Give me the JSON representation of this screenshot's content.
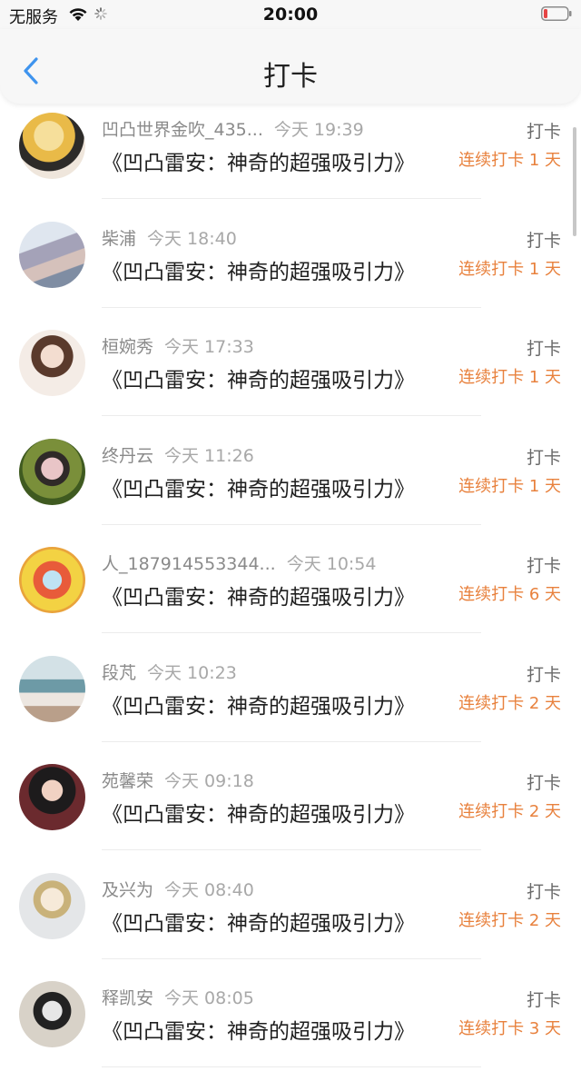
{
  "status_bar": {
    "carrier": "无服务",
    "time": "20:00",
    "icons": [
      "wifi-icon",
      "loading-icon",
      "battery-low-icon"
    ]
  },
  "nav": {
    "back_icon": "chevron-left-icon",
    "title": "打卡"
  },
  "colors": {
    "accent_blue": "#3f94ee",
    "streak_orange": "#e8813d",
    "battery_low": "#e54545"
  },
  "items": [
    {
      "name": "凹凸世界金吹_435...",
      "time": "今天 19:39",
      "title": "《凹凸雷安：神奇的超强吸引力》",
      "action": "打卡",
      "streak": "连续打卡 1 天",
      "avatar": "avatar-image"
    },
    {
      "name": "柴浦",
      "time": "今天 18:40",
      "title": "《凹凸雷安：神奇的超强吸引力》",
      "action": "打卡",
      "streak": "连续打卡 1 天",
      "avatar": "avatar-image"
    },
    {
      "name": "桓婉秀",
      "time": "今天 17:33",
      "title": "《凹凸雷安：神奇的超强吸引力》",
      "action": "打卡",
      "streak": "连续打卡 1 天",
      "avatar": "avatar-image"
    },
    {
      "name": "终丹云",
      "time": "今天 11:26",
      "title": "《凹凸雷安：神奇的超强吸引力》",
      "action": "打卡",
      "streak": "连续打卡 1 天",
      "avatar": "avatar-image"
    },
    {
      "name": "人_187914553344...",
      "time": "今天 10:54",
      "title": "《凹凸雷安：神奇的超强吸引力》",
      "action": "打卡",
      "streak": "连续打卡 6 天",
      "avatar": "avatar-image"
    },
    {
      "name": "段芃",
      "time": "今天 10:23",
      "title": "《凹凸雷安：神奇的超强吸引力》",
      "action": "打卡",
      "streak": "连续打卡 2 天",
      "avatar": "avatar-image"
    },
    {
      "name": "苑馨荣",
      "time": "今天 09:18",
      "title": "《凹凸雷安：神奇的超强吸引力》",
      "action": "打卡",
      "streak": "连续打卡 2 天",
      "avatar": "avatar-image"
    },
    {
      "name": "及兴为",
      "time": "今天 08:40",
      "title": "《凹凸雷安：神奇的超强吸引力》",
      "action": "打卡",
      "streak": "连续打卡 2 天",
      "avatar": "avatar-image"
    },
    {
      "name": "释凯安",
      "time": "今天 08:05",
      "title": "《凹凸雷安：神奇的超强吸引力》",
      "action": "打卡",
      "streak": "连续打卡 3 天",
      "avatar": "avatar-image"
    }
  ]
}
